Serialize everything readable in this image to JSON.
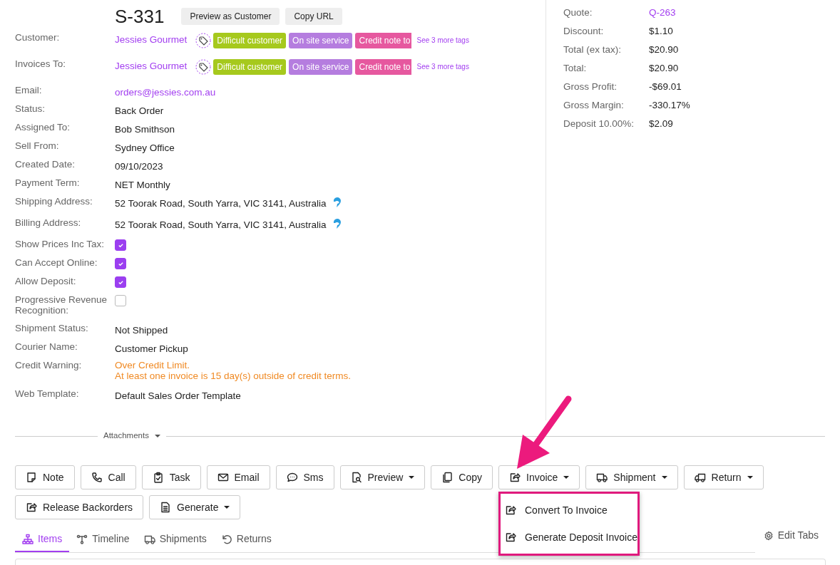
{
  "order": {
    "number": "S-331",
    "actions": [
      "Preview as Customer",
      "Copy URL"
    ]
  },
  "fields": [
    {
      "kind": "party",
      "label": "Customer:",
      "value": "Jessies Gourmet",
      "tags": [
        {
          "text": "Difficult customer",
          "color": "#a6c91d"
        },
        {
          "text": "On site service",
          "color": "#b57ddf"
        },
        {
          "text": "Credit note to",
          "color": "#e6589f"
        }
      ],
      "more": "See 3 more tags"
    },
    {
      "kind": "party",
      "label": "Invoices To:",
      "value": "Jessies Gourmet",
      "tags": [
        {
          "text": "Difficult customer",
          "color": "#a6c91d"
        },
        {
          "text": "On site service",
          "color": "#b57ddf"
        },
        {
          "text": "Credit note to",
          "color": "#e6589f"
        }
      ],
      "more": "See 3 more tags"
    },
    {
      "kind": "link",
      "label": "Email:",
      "value": "orders@jessies.com.au"
    },
    {
      "kind": "text",
      "label": "Status:",
      "value": "Back Order"
    },
    {
      "kind": "text",
      "label": "Assigned To:",
      "value": "Bob Smithson"
    },
    {
      "kind": "text",
      "label": "Sell From:",
      "value": "Sydney Office"
    },
    {
      "kind": "text",
      "label": "Created Date:",
      "value": "09/10/2023"
    },
    {
      "kind": "text",
      "label": "Payment Term:",
      "value": "NET Monthly"
    },
    {
      "kind": "address",
      "label": "Shipping Address:",
      "value": "52 Toorak Road, South Yarra, VIC 3141, Australia"
    },
    {
      "kind": "address",
      "label": "Billing Address:",
      "value": "52 Toorak Road, South Yarra, VIC 3141, Australia"
    },
    {
      "kind": "checkbox",
      "label": "Show Prices Inc Tax:",
      "checked": true
    },
    {
      "kind": "checkbox",
      "label": "Can Accept Online:",
      "checked": true
    },
    {
      "kind": "checkbox",
      "label": "Allow Deposit:",
      "checked": true
    },
    {
      "kind": "checkbox",
      "label": "Progressive Revenue Recognition:",
      "checked": false
    },
    {
      "kind": "text",
      "label": "Shipment Status:",
      "value": "Not Shipped"
    },
    {
      "kind": "text",
      "label": "Courier Name:",
      "value": "Customer Pickup"
    },
    {
      "kind": "warning",
      "label": "Credit Warning:",
      "lines": [
        "Over Credit Limit.",
        "At least one invoice is 15 day(s) outside of credit terms."
      ]
    },
    {
      "kind": "text",
      "label": "Web Template:",
      "value": "Default Sales Order Template"
    }
  ],
  "summary": [
    {
      "kind": "link",
      "label": "Quote:",
      "value": "Q-263"
    },
    {
      "kind": "text",
      "label": "Discount:",
      "value": "$1.10"
    },
    {
      "kind": "text",
      "label": "Total (ex tax):",
      "value": "$20.90"
    },
    {
      "kind": "text",
      "label": "Total:",
      "value": "$20.90"
    },
    {
      "kind": "text",
      "label": "Gross Profit:",
      "value": "-$69.01"
    },
    {
      "kind": "text",
      "label": "Gross Margin:",
      "value": "-330.17%"
    },
    {
      "kind": "text",
      "label": "Deposit 10.00%:",
      "value": "$2.09"
    }
  ],
  "attachments": {
    "label": "Attachments",
    "expanded": false
  },
  "toolbar": [
    [
      {
        "label": "Note",
        "dropdown": false
      },
      {
        "label": "Call",
        "dropdown": false
      },
      {
        "label": "Task",
        "dropdown": false
      },
      {
        "label": "Email",
        "dropdown": false
      },
      {
        "label": "Sms",
        "dropdown": false
      },
      {
        "label": "Preview",
        "dropdown": true
      },
      {
        "label": "Copy",
        "dropdown": false
      },
      {
        "label": "Invoice",
        "dropdown": true,
        "expanded": true,
        "menu": [
          "Convert To Invoice",
          "Generate Deposit Invoice"
        ]
      },
      {
        "label": "Shipment",
        "dropdown": true
      },
      {
        "label": "Return",
        "dropdown": true
      }
    ],
    [
      {
        "label": "Release Backorders",
        "dropdown": false
      },
      {
        "label": "Generate",
        "dropdown": true
      }
    ]
  ],
  "tabs": [
    {
      "label": "Items",
      "selected": true
    },
    {
      "label": "Timeline",
      "selected": false
    },
    {
      "label": "Shipments",
      "selected": false
    },
    {
      "label": "Returns",
      "selected": false
    }
  ],
  "edit_tabs": "Edit Tabs"
}
